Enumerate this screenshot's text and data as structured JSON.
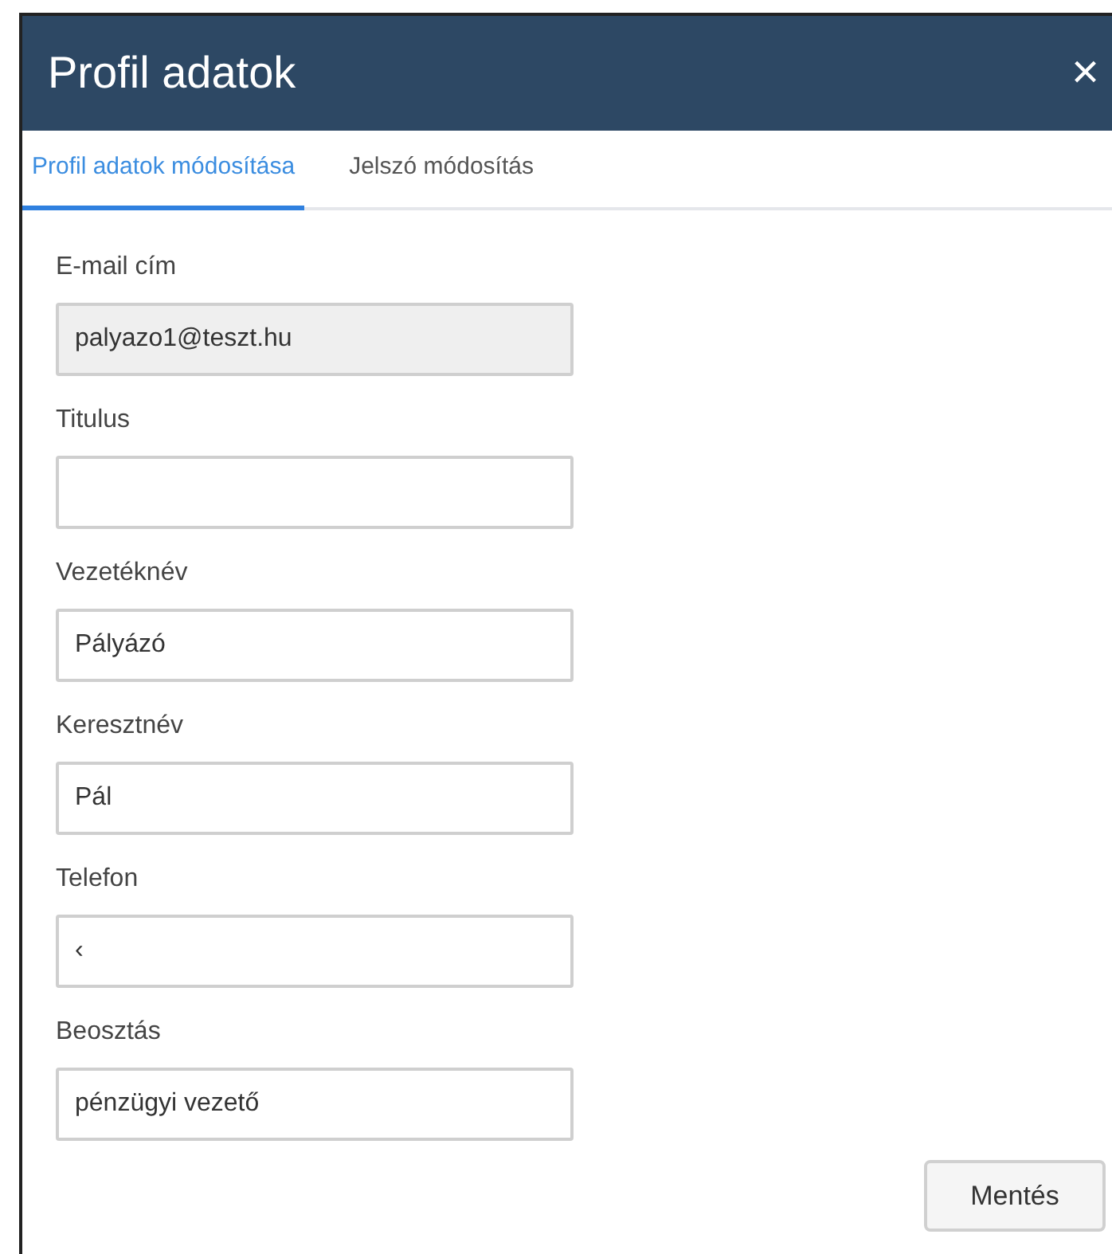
{
  "window": {
    "title": "Profil adatok",
    "close": "×"
  },
  "tabs": [
    {
      "label": "Profil adatok módosítása",
      "selected": true
    },
    {
      "label": "Jelszó módosítás",
      "selected": false
    }
  ],
  "fields": [
    {
      "label": "E-mail cím",
      "value": "palyazo1@teszt.hu",
      "disabled": true
    },
    {
      "label": "Titulus",
      "disabled": false
    },
    {
      "label": "Vezetéknév",
      "value": "Pályázó",
      "disabled": false
    },
    {
      "label": "Keresztnév",
      "value": "Pál",
      "disabled": false
    },
    {
      "label": "Telefon",
      "value": "‹",
      "disabled": false
    },
    {
      "label": "Beosztás",
      "value": "pénzügyi vezető",
      "disabled": false
    }
  ],
  "save_button": "Mentés"
}
